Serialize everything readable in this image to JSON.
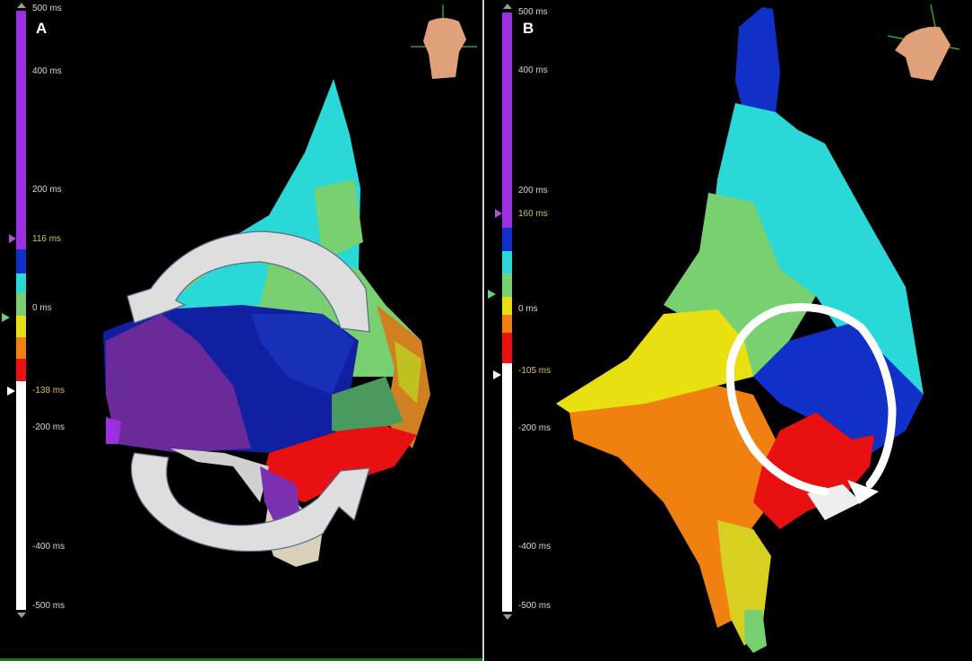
{
  "panels": [
    {
      "label": "A",
      "scale": {
        "ticks": [
          {
            "text": "500 ms",
            "value": 500
          },
          {
            "text": "400 ms",
            "value": 400
          },
          {
            "text": "200 ms",
            "value": 200
          },
          {
            "text": "116 ms",
            "value": 116,
            "active": true
          },
          {
            "text": "0 ms",
            "value": 0
          },
          {
            "text": "-138 ms",
            "value": -138,
            "active": true
          },
          {
            "text": "-200 ms",
            "value": -200
          },
          {
            "text": "-400 ms",
            "value": -400
          },
          {
            "text": "-500 ms",
            "value": -500
          }
        ],
        "upper_threshold_ms": 116,
        "lower_threshold_ms": -138
      }
    },
    {
      "label": "B",
      "scale": {
        "ticks": [
          {
            "text": "500 ms",
            "value": 500
          },
          {
            "text": "400 ms",
            "value": 400
          },
          {
            "text": "200 ms",
            "value": 200
          },
          {
            "text": "160 ms",
            "value": 160,
            "active": true
          },
          {
            "text": "0 ms",
            "value": 0
          },
          {
            "text": "-105 ms",
            "value": -105,
            "active": true
          },
          {
            "text": "-200 ms",
            "value": -200
          },
          {
            "text": "-400 ms",
            "value": -400
          },
          {
            "text": "-500 ms",
            "value": -500
          }
        ],
        "upper_threshold_ms": 160,
        "lower_threshold_ms": -105
      }
    }
  ],
  "colors": {
    "late": "#9b30e0",
    "blue": "#1030c8",
    "cyan": "#2ad8d8",
    "green": "#78d070",
    "yellow": "#e8e010",
    "orange": "#f08010",
    "red": "#e81010",
    "unmapped": "#ffffff",
    "purple_tissue": "#6a2a9a",
    "scar": "#d8d0b8",
    "torso": "#e0a07a"
  },
  "icons": [
    "torso-orientation-icon",
    "rotation-arrow-icon",
    "circular-arrow-icon"
  ]
}
